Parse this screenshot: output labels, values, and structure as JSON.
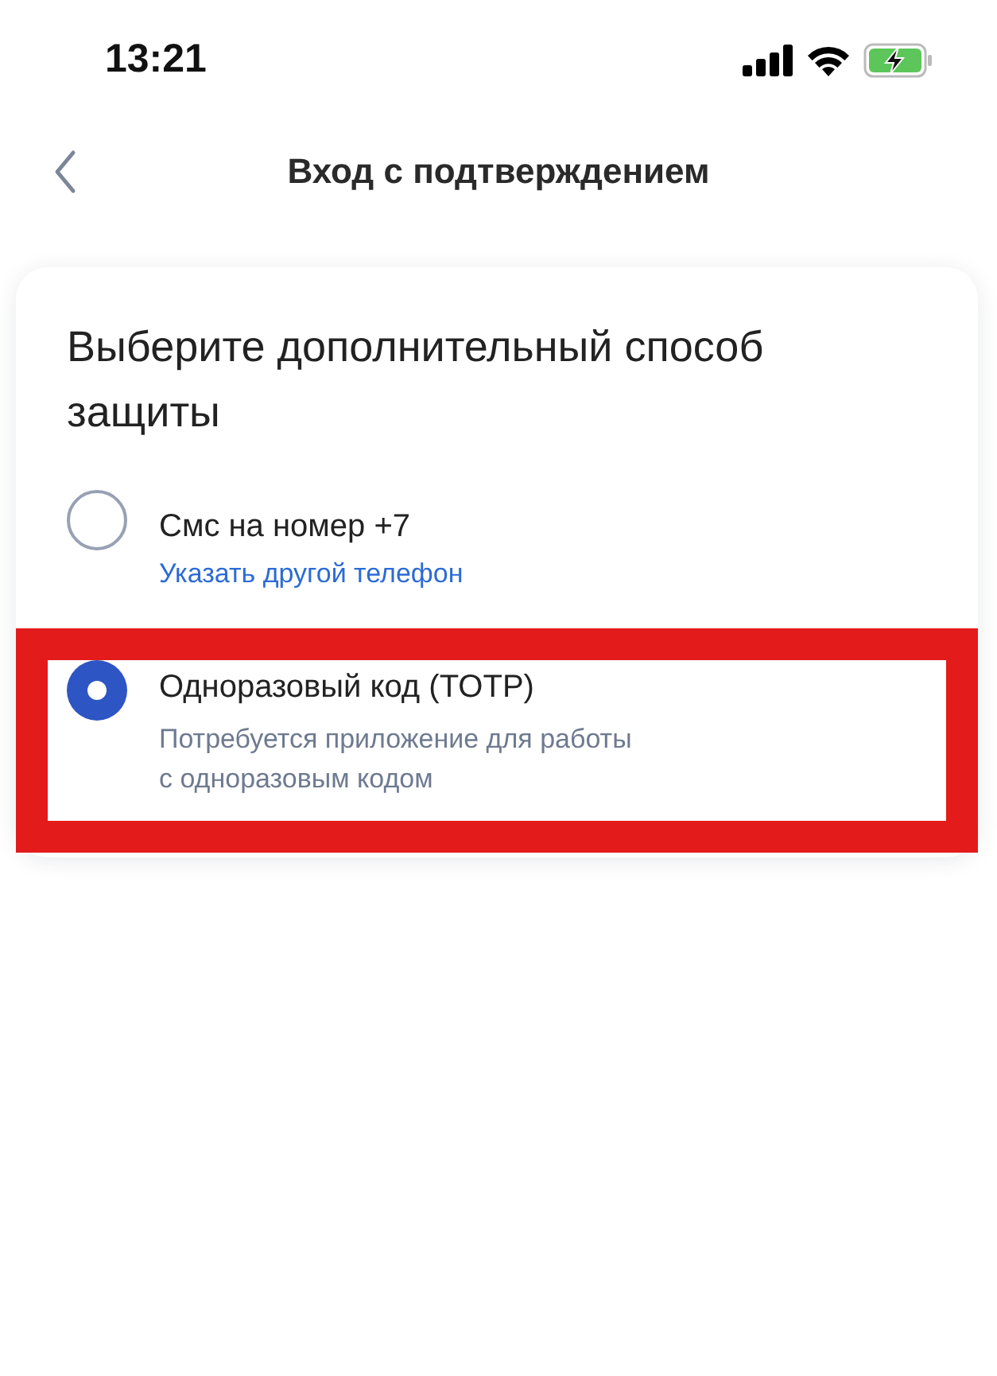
{
  "status_bar": {
    "time": "13:21"
  },
  "nav": {
    "title": "Вход с подтверждением"
  },
  "card": {
    "title": "Выберите дополнительный способ защиты",
    "options": [
      {
        "kind": "link",
        "label": "Смс на номер +7",
        "selected": false,
        "highlighted": false,
        "link": "Указать другой телефон"
      },
      {
        "kind": "description",
        "label": "Одноразовый код (TOTP)",
        "selected": true,
        "highlighted": true,
        "description": "Потребуется приложение для работы\nс одноразовым кодом"
      }
    ]
  }
}
